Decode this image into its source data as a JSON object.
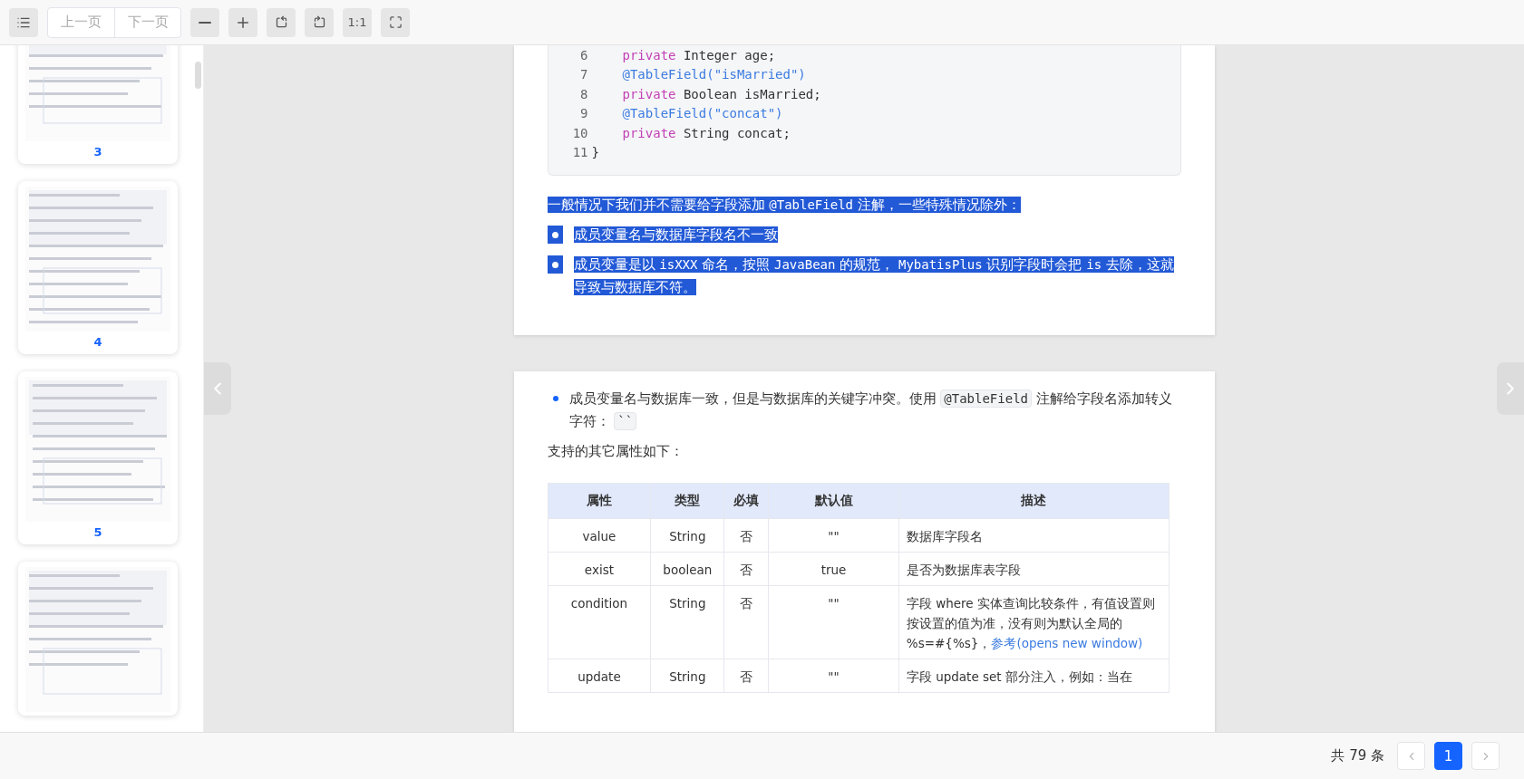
{
  "toolbar": {
    "prev_page": "上一页",
    "next_page": "下一页",
    "actual_size": "1:1"
  },
  "sidebar": {
    "thumbnails": [
      {
        "label": "3"
      },
      {
        "label": "4"
      },
      {
        "label": "5"
      }
    ],
    "more_below": true
  },
  "pages": [
    {
      "blocks": [
        {
          "kind": "code",
          "lines": [
            {
              "number": "6",
              "indented": true,
              "tokens": [
                {
                  "kind": "keyword",
                  "text": "private"
                },
                {
                  "kind": "plain",
                  "text": " Integer age;"
                }
              ]
            },
            {
              "number": "7",
              "indented": true,
              "tokens": [
                {
                  "kind": "annotation",
                  "text": "@TableField(\"isMarried\")"
                }
              ]
            },
            {
              "number": "8",
              "indented": true,
              "tokens": [
                {
                  "kind": "keyword",
                  "text": "private"
                },
                {
                  "kind": "plain",
                  "text": " Boolean isMarried;"
                }
              ]
            },
            {
              "number": "9",
              "indented": true,
              "tokens": [
                {
                  "kind": "annotation",
                  "text": "@TableField(\"concat\")"
                }
              ]
            },
            {
              "number": "10",
              "indented": true,
              "tokens": [
                {
                  "kind": "keyword",
                  "text": "private"
                },
                {
                  "kind": "plain",
                  "text": " String concat;"
                }
              ]
            },
            {
              "number": "11",
              "indented": false,
              "tokens": [
                {
                  "kind": "plain",
                  "text": "}"
                }
              ]
            }
          ]
        },
        {
          "kind": "paragraph",
          "highlighted": true,
          "segments": [
            {
              "kind": "text",
              "text": "一般情况下我们并不需要给字段添加 "
            },
            {
              "kind": "code",
              "text": "@TableField"
            },
            {
              "kind": "text",
              "text": " 注解，一些特殊情况除外："
            }
          ]
        },
        {
          "kind": "bullet",
          "highlighted": true,
          "segments": [
            {
              "kind": "text",
              "text": "成员变量名与数据库字段名不一致"
            }
          ]
        },
        {
          "kind": "bullet",
          "highlighted": true,
          "segments": [
            {
              "kind": "text",
              "text": "成员变量是以 "
            },
            {
              "kind": "code",
              "text": "isXXX"
            },
            {
              "kind": "text",
              "text": " 命名，按照 "
            },
            {
              "kind": "code",
              "text": "JavaBean"
            },
            {
              "kind": "text",
              "text": " 的规范， "
            },
            {
              "kind": "code",
              "text": "MybatisPlus"
            },
            {
              "kind": "text",
              "text": " 识别字段时会把 "
            },
            {
              "kind": "code",
              "text": "is"
            },
            {
              "kind": "text",
              "text": " 去除，这就导致与数据库不符。"
            }
          ]
        }
      ]
    },
    {
      "blocks": [
        {
          "kind": "bullet",
          "highlighted": false,
          "segments": [
            {
              "kind": "text",
              "text": "成员变量名与数据库一致，但是与数据库的关键字冲突。使用 "
            },
            {
              "kind": "codebox",
              "text": "@TableField"
            },
            {
              "kind": "text",
              "text": " 注解给字段名添加转义字符： "
            },
            {
              "kind": "codebox",
              "text": "``"
            }
          ]
        },
        {
          "kind": "paragraph",
          "highlighted": false,
          "segments": [
            {
              "kind": "text",
              "text": "支持的其它属性如下："
            }
          ]
        },
        {
          "kind": "table",
          "columns": [
            "属性",
            "类型",
            "必填",
            "默认值",
            "描述"
          ],
          "rows": [
            [
              "value",
              "String",
              "否",
              "\"\"",
              [
                {
                  "kind": "text",
                  "text": "数据库字段名"
                }
              ]
            ],
            [
              "exist",
              "boolean",
              "否",
              "true",
              [
                {
                  "kind": "text",
                  "text": "是否为数据库表字段"
                }
              ]
            ],
            [
              "condition",
              "String",
              "否",
              "\"\"",
              [
                {
                  "kind": "text",
                  "text": "字段 where 实体查询比较条件，有值设置则按设置的值为准，没有则为默认全局的 %s=#{%s}，"
                },
                {
                  "kind": "link",
                  "text": "参考(opens new window)"
                }
              ]
            ],
            [
              "update",
              "String",
              "否",
              "\"\"",
              [
                {
                  "kind": "text",
                  "text": "字段 update set 部分注入，例如：当在"
                }
              ]
            ]
          ]
        }
      ]
    }
  ],
  "pagination": {
    "total": "共 79 条",
    "pages": [
      {
        "label": "1",
        "selected": true
      }
    ]
  }
}
